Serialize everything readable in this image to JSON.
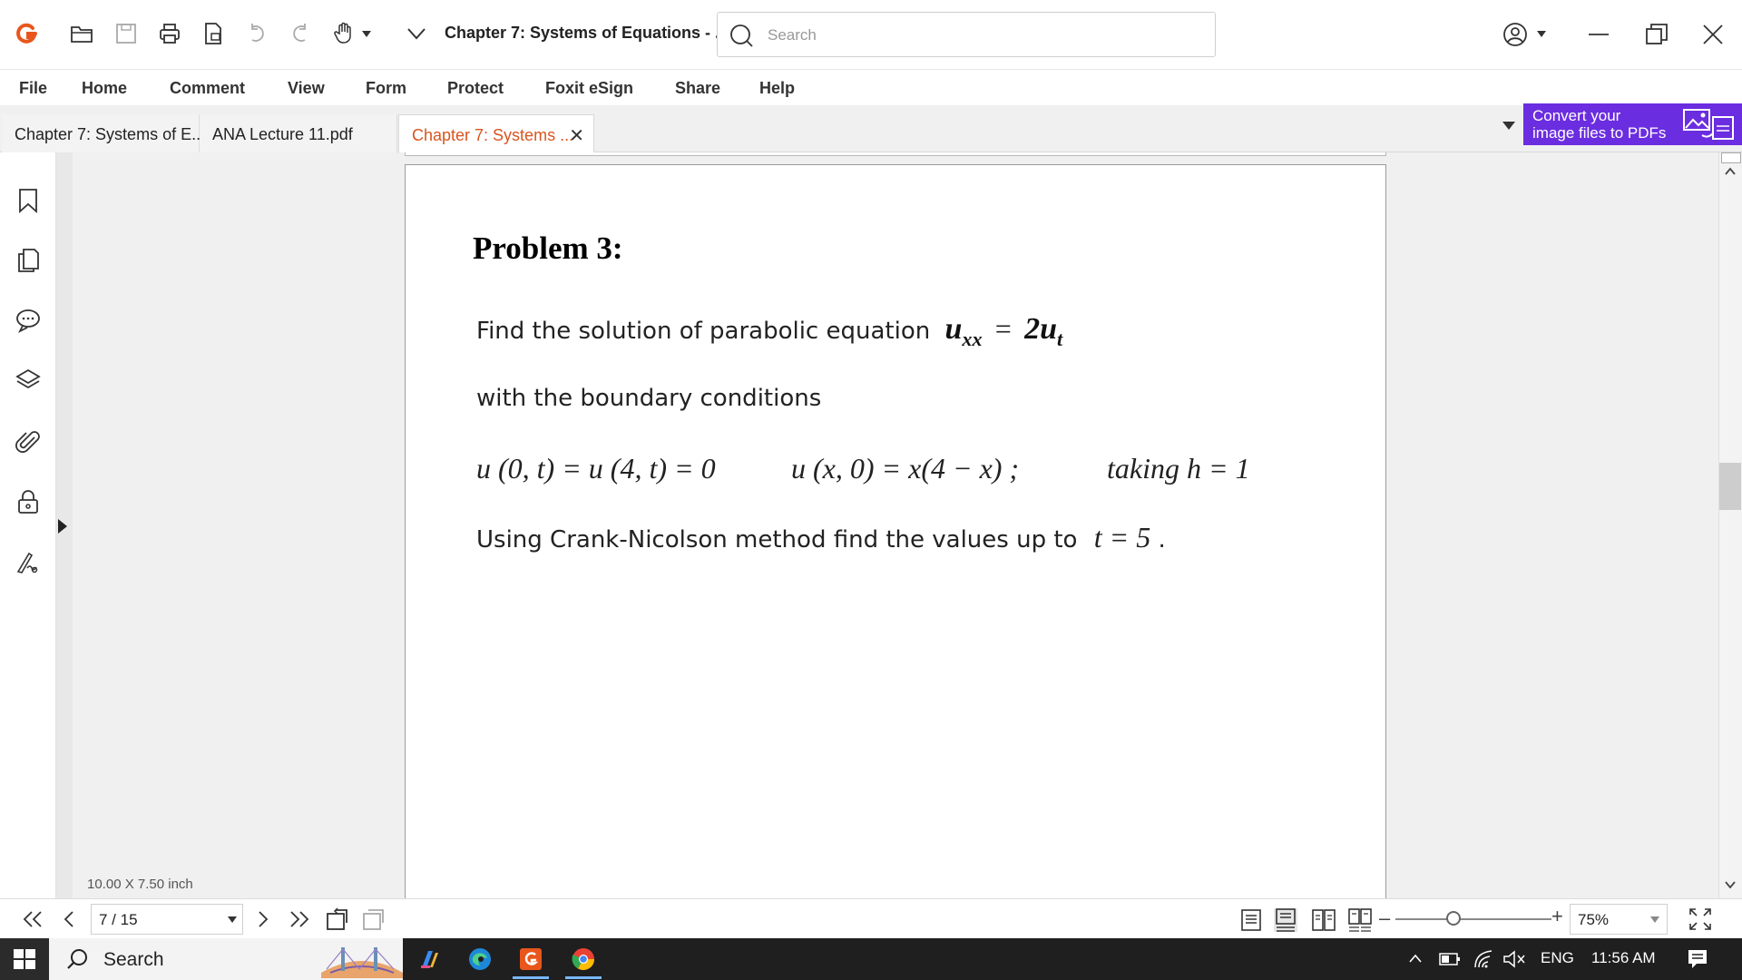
{
  "app": {
    "document_title": "Chapter 7: Systems of Equations - ...",
    "search_placeholder": "Search"
  },
  "menu": [
    "File",
    "Home",
    "Comment",
    "View",
    "Form",
    "Protect",
    "Foxit eSign",
    "Share",
    "Help"
  ],
  "tabs": [
    {
      "label": "Chapter 7: Systems of E...",
      "active": false
    },
    {
      "label": "ANA Lecture 11.pdf",
      "active": false
    },
    {
      "label": "Chapter 7: Systems ...",
      "active": true
    }
  ],
  "tab_close_glyph": "✕",
  "promo": {
    "line1": "Convert your",
    "line2": "image files to PDFs"
  },
  "document": {
    "problem_title": "Problem 3:",
    "line1_text": "Find the solution of parabolic equation",
    "line1_math_lhs": "u",
    "line1_math_lhs_sub": "xx",
    "line1_math_eq": "=",
    "line1_math_rhs": "2u",
    "line1_math_rhs_sub": "t",
    "line2_text": "with the boundary conditions",
    "line3_bc1": "u (0, t) =  u (4, t) = 0",
    "line3_bc2": "u (x, 0) = x(4 − x) ;",
    "line3_bc3": "taking  h = 1",
    "line4_text": "Using Crank-Nicolson method find the values up to",
    "line4_math": "t = 5",
    "line4_end": "."
  },
  "page_size": "10.00 X 7.50 inch",
  "status": {
    "page_indicator": "7 / 15",
    "zoom": "75%"
  },
  "taskbar": {
    "search_label": "Search",
    "language": "ENG",
    "time": "11:56 AM"
  },
  "colors": {
    "accent_orange": "#d9541e",
    "promo_purple": "#6b2de0",
    "taskbar_bg": "#1f1f1f"
  },
  "icons": {
    "quick_access": [
      "foxit-logo-icon",
      "open-folder-icon",
      "save-icon",
      "print-icon",
      "new-pdf-icon",
      "undo-icon",
      "redo-icon",
      "hand-tool-icon",
      "customize-dropdown-icon"
    ],
    "left_nav": [
      "bookmark-icon",
      "pages-icon",
      "comments-icon",
      "layers-icon",
      "attachments-icon",
      "security-icon",
      "signature-icon"
    ]
  }
}
